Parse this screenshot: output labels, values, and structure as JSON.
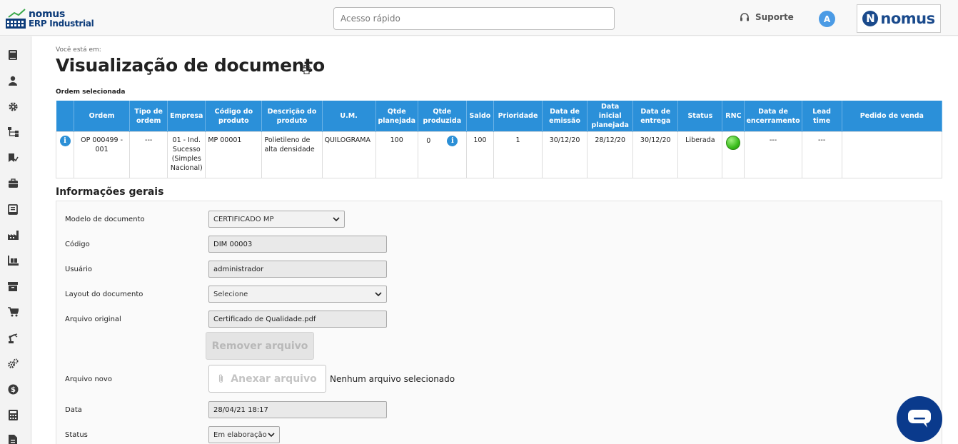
{
  "header": {
    "logo_line1": "nomus",
    "logo_line2": "ERP Industrial",
    "search_placeholder": "Acesso rápido",
    "support_label": "Suporte",
    "avatar_initial": "A",
    "brand_letter": "N",
    "brand_word": "nomus"
  },
  "sidebar": {
    "items": [
      {
        "icon": "book-icon"
      },
      {
        "icon": "user-icon"
      },
      {
        "icon": "gear-icon"
      },
      {
        "icon": "network-icon"
      },
      {
        "icon": "flag-check-icon"
      },
      {
        "icon": "briefcase-icon"
      },
      {
        "icon": "ledger-icon"
      },
      {
        "icon": "factory-icon"
      },
      {
        "icon": "pallet-icon"
      },
      {
        "icon": "archive-icon"
      },
      {
        "icon": "cart-icon"
      },
      {
        "icon": "robot-arm-icon"
      },
      {
        "icon": "gears-icon"
      },
      {
        "icon": "dollar-icon"
      },
      {
        "icon": "calculator-icon"
      },
      {
        "icon": "document-icon"
      }
    ]
  },
  "page": {
    "breadcrumb": "Você está em:",
    "title": "Visualização de documento",
    "selected_order_label": "Ordem selecionada"
  },
  "order_table": {
    "headers": [
      "Ordem",
      "Tipo de ordem",
      "Empresa",
      "Código do produto",
      "Descrição do produto",
      "U.M.",
      "Qtde planejada",
      "Qtde produzida",
      "Saldo",
      "Prioridade",
      "Data de emissão",
      "Data inicial planejada",
      "Data de entrega",
      "Status",
      "RNC",
      "Data de encerramento",
      "Lead time",
      "Pedido de venda"
    ],
    "row": {
      "ordem": "OP 000499 - 001",
      "tipo": "---",
      "empresa": "01 - Ind. Sucesso (Simples Nacional)",
      "codigo": "MP 00001",
      "descricao": "Polietileno de alta densidade",
      "um": "QUILOGRAMA",
      "qtde_planejada": "100",
      "qtde_produzida": "0",
      "saldo": "100",
      "prioridade": "1",
      "data_emissao": "30/12/20",
      "data_inicial": "28/12/20",
      "data_entrega": "30/12/20",
      "status": "Liberada",
      "data_encerramento": "---",
      "lead_time": "---",
      "pedido_venda": ""
    }
  },
  "form": {
    "section_title": "Informações gerais",
    "modelo_label": "Modelo de documento",
    "modelo_value": "CERTIFICADO MP",
    "codigo_label": "Código",
    "codigo_value": "DIM 00003",
    "usuario_label": "Usuário",
    "usuario_value": "administrador",
    "layout_label": "Layout do documento",
    "layout_value": "Selecione",
    "arquivo_original_label": "Arquivo original",
    "arquivo_original_value": "Certificado de Qualidade.pdf",
    "remover_label": "Remover arquivo",
    "arquivo_novo_label": "Arquivo novo",
    "anexar_label": "Anexar arquivo",
    "no_file_text": "Nenhum arquivo selecionado",
    "data_label": "Data",
    "data_value": "28/04/21 18:17",
    "status_label": "Status",
    "status_value": "Em elaboração"
  },
  "colors": {
    "table_header": "#2b90d9",
    "brand_blue": "#1a4a8c",
    "chat_fab": "#0a3a8c",
    "rnc_ok": "#3bbd1d"
  }
}
